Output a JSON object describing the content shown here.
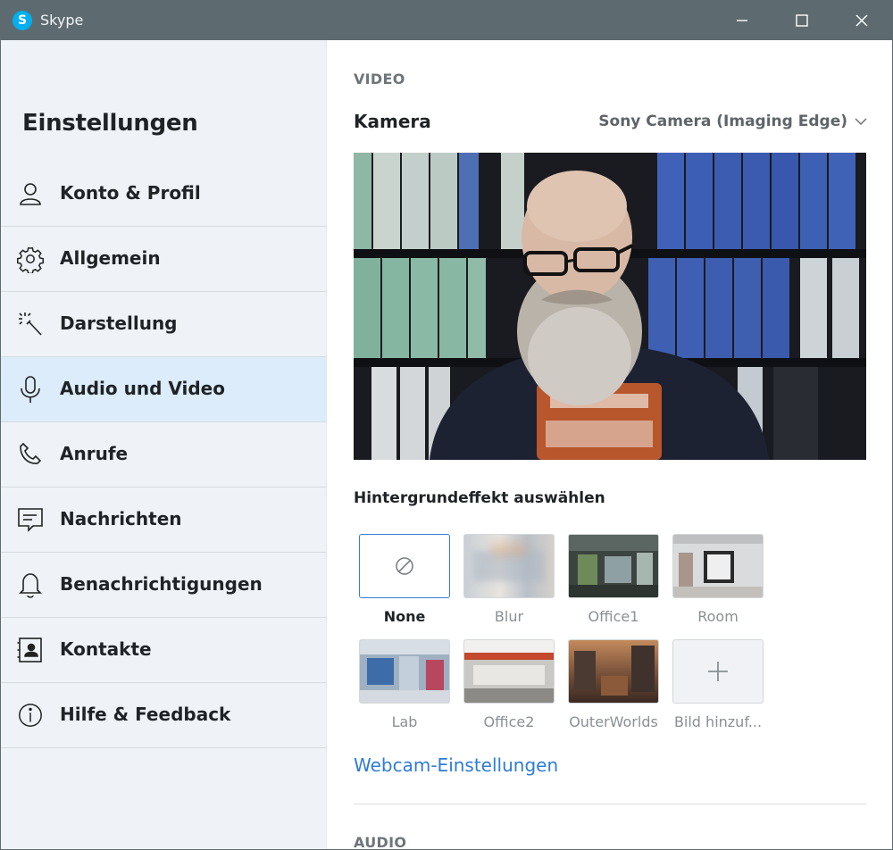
{
  "window": {
    "app_name": "Skype",
    "logo_letter": "S"
  },
  "sidebar": {
    "title": "Einstellungen",
    "items": [
      {
        "label": "Konto & Profil",
        "icon": "person-icon",
        "active": false
      },
      {
        "label": "Allgemein",
        "icon": "gear-icon",
        "active": false
      },
      {
        "label": "Darstellung",
        "icon": "magic-wand-icon",
        "active": false
      },
      {
        "label": "Audio und Video",
        "icon": "microphone-icon",
        "active": true
      },
      {
        "label": "Anrufe",
        "icon": "phone-icon",
        "active": false
      },
      {
        "label": "Nachrichten",
        "icon": "message-icon",
        "active": false
      },
      {
        "label": "Benachrichtigungen",
        "icon": "bell-icon",
        "active": false
      },
      {
        "label": "Kontakte",
        "icon": "contact-card-icon",
        "active": false
      },
      {
        "label": "Hilfe & Feedback",
        "icon": "info-icon",
        "active": false
      }
    ]
  },
  "main": {
    "video_section": "VIDEO",
    "camera_label": "Kamera",
    "camera_selected": "Sony Camera (Imaging Edge)",
    "background_heading": "Hintergrundeffekt auswählen",
    "backgrounds": [
      {
        "label": "None",
        "selected": true
      },
      {
        "label": "Blur",
        "selected": false
      },
      {
        "label": "Office1",
        "selected": false
      },
      {
        "label": "Room",
        "selected": false
      },
      {
        "label": "Lab",
        "selected": false
      },
      {
        "label": "Office2",
        "selected": false
      },
      {
        "label": "OuterWorlds",
        "selected": false
      },
      {
        "label": "Bild hinzuf...",
        "selected": false
      }
    ],
    "webcam_link": "Webcam-Einstellungen",
    "audio_section": "AUDIO"
  },
  "colors": {
    "titlebar": "#5d6b70",
    "sidebar_bg": "#eff3f8",
    "active_item": "#dcecfa",
    "accent": "#2e7cd6",
    "skype_blue": "#00aff0"
  }
}
